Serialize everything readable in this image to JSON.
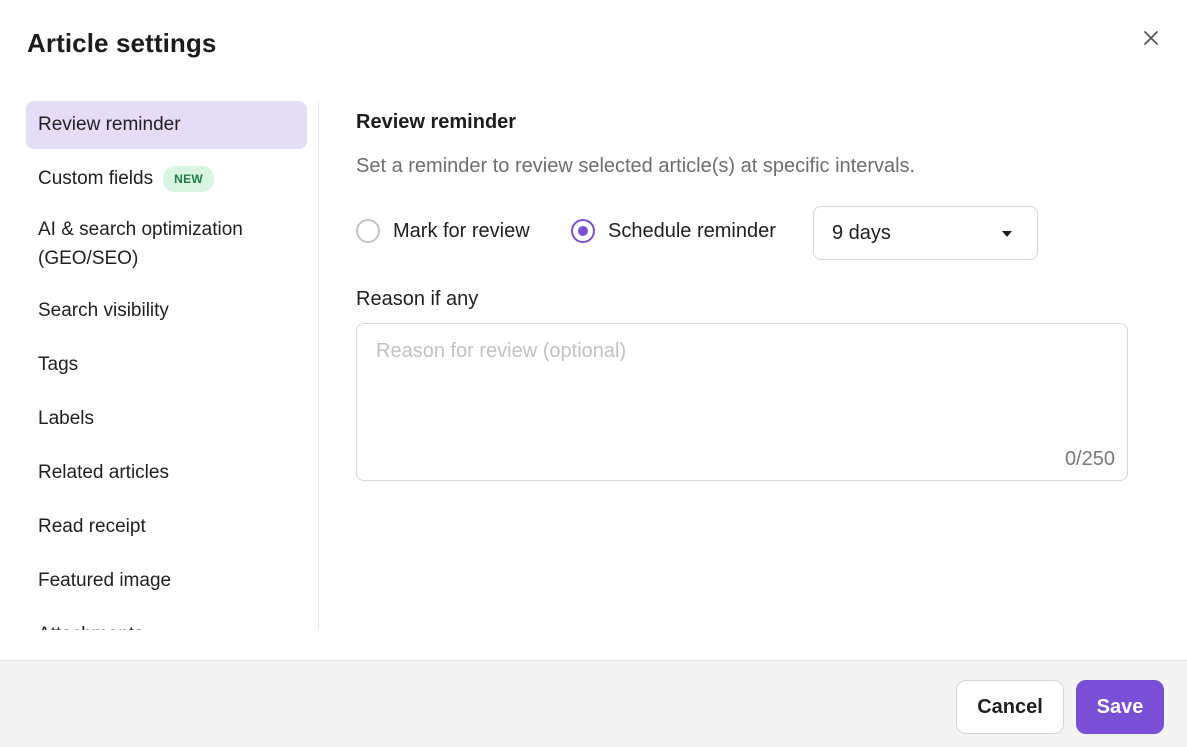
{
  "dialog": {
    "title": "Article settings",
    "close_icon": "close-icon"
  },
  "sidebar": {
    "items": [
      {
        "label": "Review reminder",
        "active": true
      },
      {
        "label": "Custom fields",
        "badge": "NEW"
      },
      {
        "label": "AI & search optimization",
        "label_line2": "(GEO/SEO)"
      },
      {
        "label": "Search visibility"
      },
      {
        "label": "Tags"
      },
      {
        "label": "Labels"
      },
      {
        "label": "Related articles"
      },
      {
        "label": "Read receipt"
      },
      {
        "label": "Featured image"
      },
      {
        "label": "Attachments"
      }
    ]
  },
  "main": {
    "section_title": "Review reminder",
    "section_description": "Set a reminder to review selected article(s) at specific intervals.",
    "radio_options": [
      {
        "label": "Mark for review",
        "checked": false
      },
      {
        "label": "Schedule reminder",
        "checked": true
      }
    ],
    "interval_select": {
      "value": "9 days"
    },
    "reason": {
      "label": "Reason if any",
      "placeholder": "Reason for review (optional)",
      "value": "",
      "counter": "0/250"
    }
  },
  "footer": {
    "cancel_label": "Cancel",
    "save_label": "Save"
  },
  "colors": {
    "accent": "#7a4fd6",
    "active_nav_bg": "#e5dcf7",
    "badge_bg": "#d7f5e1",
    "badge_text": "#1f7a43",
    "footer_bg": "#f3f3f3"
  }
}
